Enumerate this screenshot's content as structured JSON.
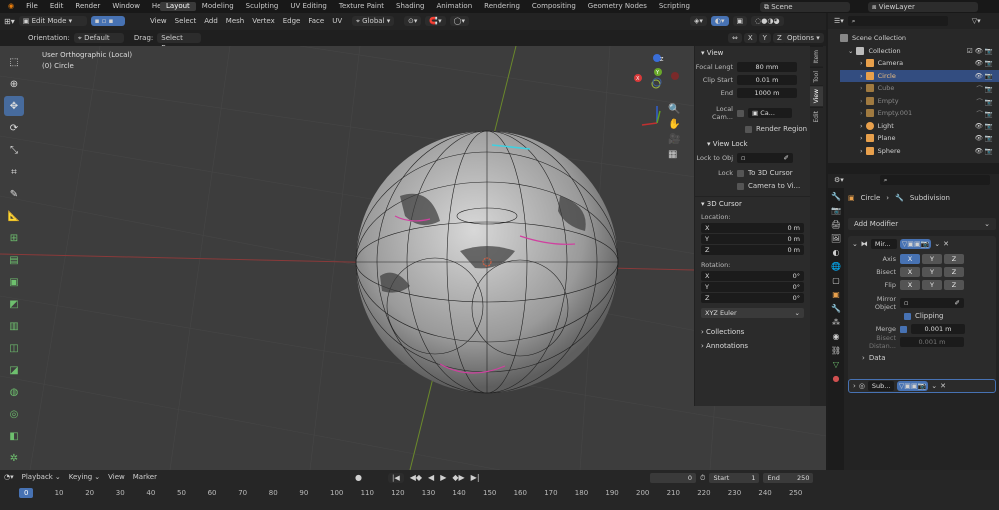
{
  "menu": [
    "File",
    "Edit",
    "Render",
    "Window",
    "Help"
  ],
  "workspaces": [
    "Layout",
    "Modeling",
    "Sculpting",
    "UV Editing",
    "Texture Paint",
    "Shading",
    "Animation",
    "Rendering",
    "Compositing",
    "Geometry Nodes",
    "Scripting"
  ],
  "active_workspace": "Layout",
  "scene_name": "Scene",
  "view_layer": "ViewLayer",
  "header": {
    "mode": "Edit Mode",
    "menus": [
      "View",
      "Select",
      "Add",
      "Mesh",
      "Vertex",
      "Edge",
      "Face",
      "UV"
    ],
    "transform_orientation": "Global",
    "options": "Options"
  },
  "subheader": {
    "orientation_label": "Orientation:",
    "orientation_value": "Default",
    "drag_label": "Drag:",
    "drag_value": "Select Box"
  },
  "viewport": {
    "view_name": "User Orthographic (Local)",
    "object_name": "(0) Circle",
    "axis_labels": {
      "x": "X",
      "y": "Y",
      "z": "Z"
    }
  },
  "npanel": {
    "tabs": [
      "Item",
      "Tool",
      "View",
      "Edit"
    ],
    "active_tab": "View",
    "view_section": "View",
    "focal_length_label": "Focal Lengt",
    "focal_length": "80 mm",
    "clip_start_label": "Clip Start",
    "clip_start": "0.01 m",
    "end_label": "End",
    "end": "1000 m",
    "local_camera_label": "Local Cam...",
    "local_camera_value": "Ca...",
    "render_region": "Render Region",
    "view_lock_section": "View Lock",
    "lock_to_obj_label": "Lock to Obj",
    "lock_label": "Lock",
    "to_3d_cursor": "To 3D Cursor",
    "camera_to_view": "Camera to Vi...",
    "cursor_section": "3D Cursor",
    "location_label": "Location:",
    "location": [
      {
        "axis": "X",
        "value": "0 m"
      },
      {
        "axis": "Y",
        "value": "0 m"
      },
      {
        "axis": "Z",
        "value": "0 m"
      }
    ],
    "rotation_label": "Rotation:",
    "rotation": [
      {
        "axis": "X",
        "value": "0°"
      },
      {
        "axis": "Y",
        "value": "0°"
      },
      {
        "axis": "Z",
        "value": "0°"
      }
    ],
    "rotation_mode": "XYZ Euler",
    "collections": "Collections",
    "annotations": "Annotations"
  },
  "outliner": {
    "scene_collection": "Scene Collection",
    "collection": "Collection",
    "items": [
      {
        "name": "Camera",
        "color": "#e8a04c"
      },
      {
        "name": "Circle",
        "color": "#e8a04c"
      },
      {
        "name": "Cube",
        "color": "#e8a04c"
      },
      {
        "name": "Empty",
        "color": "#e8a04c"
      },
      {
        "name": "Empty.001",
        "color": "#e8a04c"
      },
      {
        "name": "Light",
        "color": "#e8a04c"
      },
      {
        "name": "Plane",
        "color": "#e8a04c"
      },
      {
        "name": "Sphere",
        "color": "#e8a04c"
      }
    ],
    "selected": "Circle"
  },
  "properties": {
    "breadcrumb_object": "Circle",
    "breadcrumb_modifier": "Subdivision",
    "add_modifier": "Add Modifier",
    "mirror": {
      "name": "Mir...",
      "axis_label": "Axis",
      "bisect_label": "Bisect",
      "flip_label": "Flip",
      "axes": [
        "X",
        "Y",
        "Z"
      ],
      "mirror_object_label": "Mirror Object",
      "clipping": "Clipping",
      "merge_label": "Merge",
      "merge_value": "0.001 m",
      "bisect_distance_label": "Bisect Distan...",
      "bisect_distance_value": "0.001 m",
      "data": "Data"
    },
    "subdivision_name": "Sub..."
  },
  "timeline": {
    "menus": [
      "Playback",
      "Keying",
      "View",
      "Marker"
    ],
    "current_frame": "0",
    "start_label": "Start",
    "start": "1",
    "end_label": "End",
    "end": "250",
    "ticks": [
      "0",
      "10",
      "20",
      "30",
      "40",
      "50",
      "60",
      "70",
      "80",
      "90",
      "100",
      "110",
      "120",
      "130",
      "140",
      "150",
      "160",
      "170",
      "180",
      "190",
      "200",
      "210",
      "220",
      "230",
      "240",
      "250"
    ]
  },
  "colors": {
    "accent": "#4772b3",
    "selected_row": "#334d80",
    "object_orange": "#e8a04c"
  }
}
